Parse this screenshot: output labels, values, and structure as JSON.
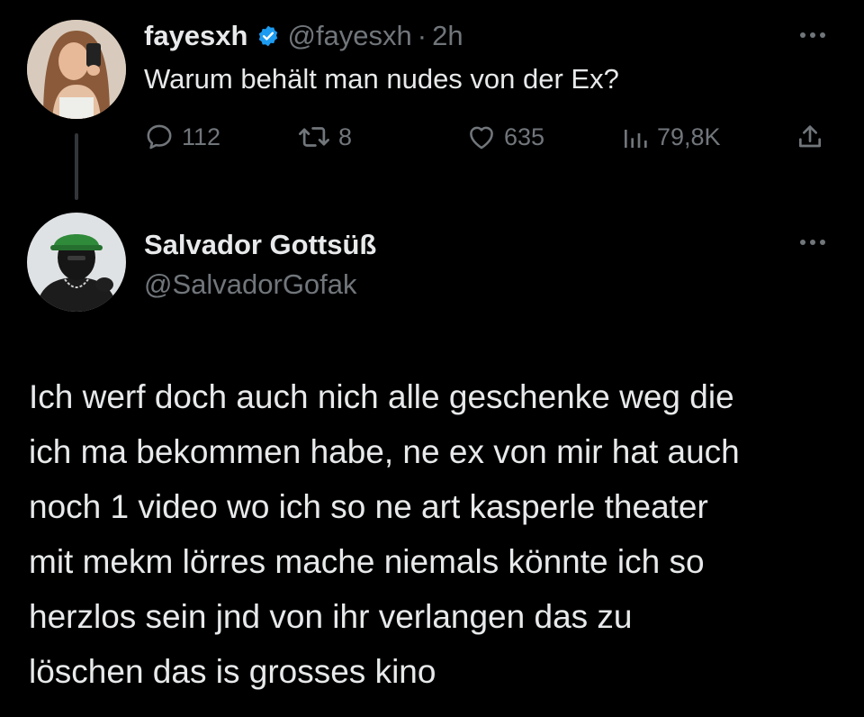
{
  "first_tweet": {
    "display_name": "fayesxh",
    "handle": "@fayesxh",
    "separator": "·",
    "time": "2h",
    "text": "Warum behält man nudes von der Ex?",
    "reply_count": "112",
    "retweet_count": "8",
    "like_count": "635",
    "view_count": "79,8K"
  },
  "second_tweet": {
    "display_name": "Salvador Gottsüß",
    "handle": "@SalvadorGofak",
    "lines": [
      "Ich werf doch auch nich alle geschenke weg die",
      "ich ma bekommen habe, ne ex von mir hat auch",
      "noch 1 video wo ich so ne art kasperle theater",
      "mit mekm lörres mache niemals könnte ich so",
      "herzlos sein jnd von ihr verlangen das zu",
      "löschen das is grosses kino"
    ]
  },
  "icons": {
    "verified": "verified-badge-icon",
    "reply": "reply-bubble-icon",
    "retweet": "retweet-icon",
    "like": "heart-icon",
    "views": "views-bar-chart-icon",
    "share": "share-upload-icon",
    "more": "more-dots-icon"
  },
  "colors": {
    "background": "#000000",
    "primary_text": "#e7e9ea",
    "secondary_text": "#71767b",
    "verified_blue": "#1d9bf0",
    "thread_line": "#333639"
  }
}
